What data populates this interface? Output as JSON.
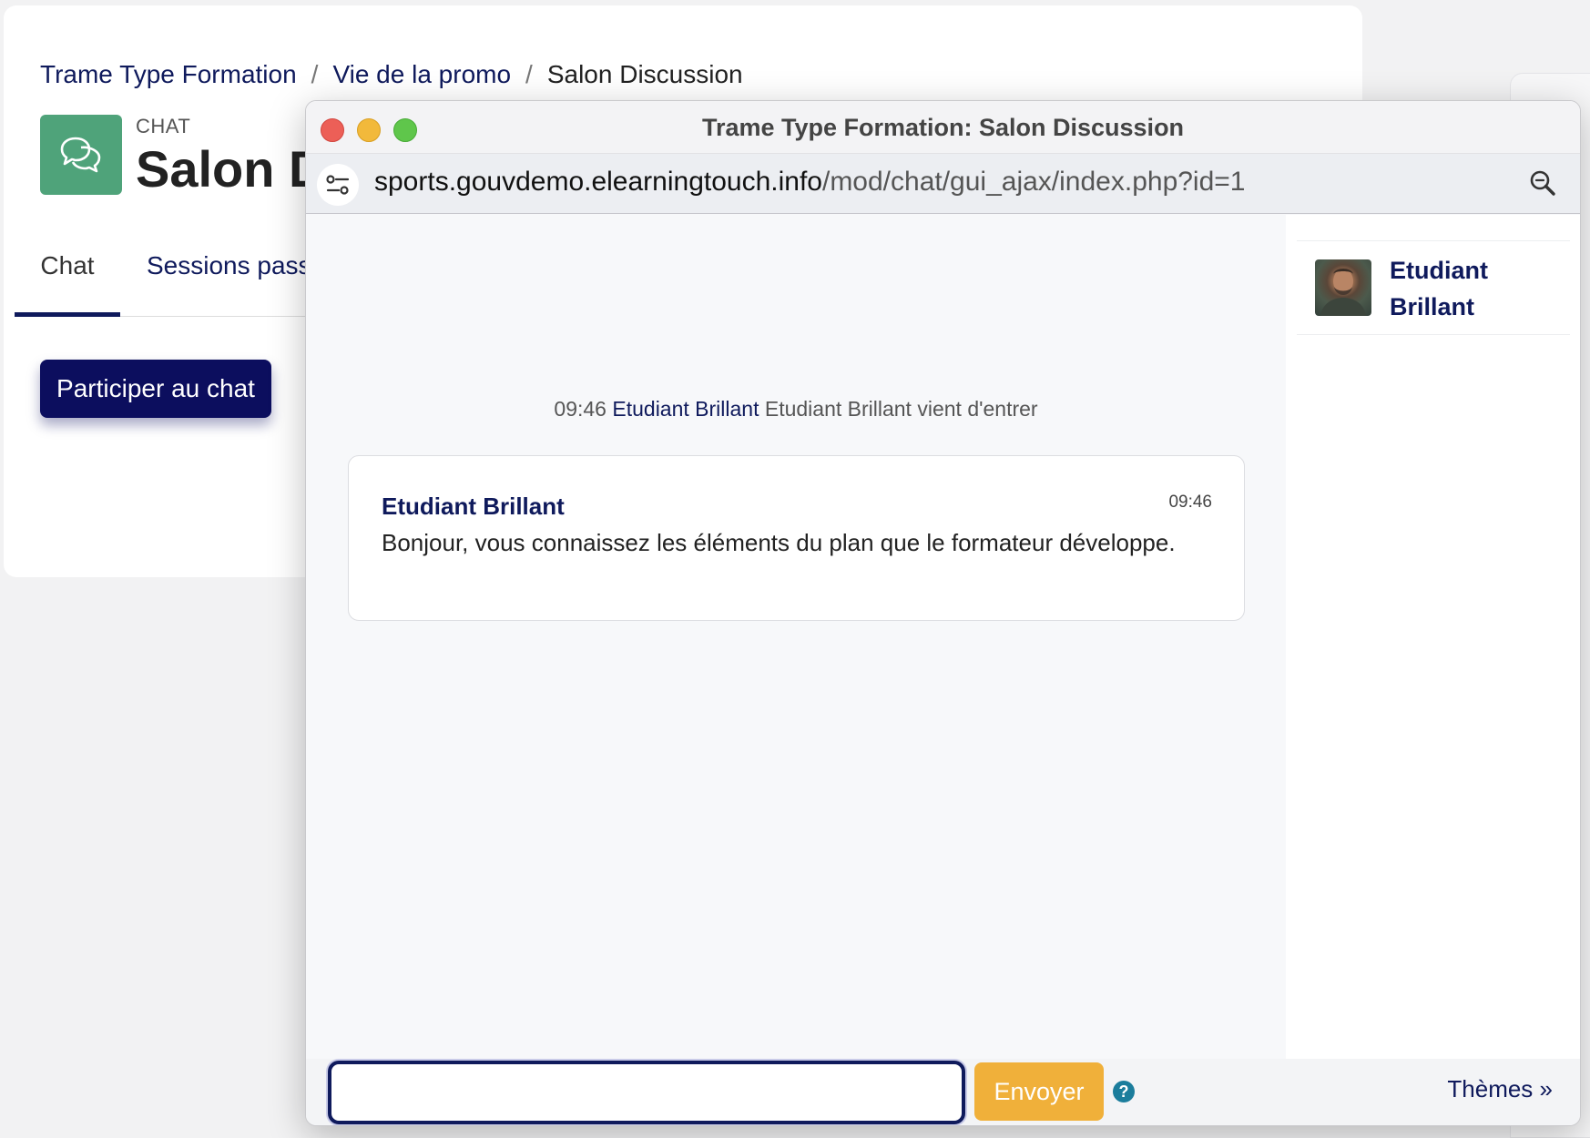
{
  "breadcrumb": {
    "items": [
      "Trame Type Formation",
      "Vie de la promo",
      "Salon Discussion"
    ],
    "separator": "/"
  },
  "module": {
    "type_label": "CHAT",
    "title": "Salon D",
    "icon": "chat-bubbles-icon",
    "icon_bg_color": "#4fa37a"
  },
  "tabs": {
    "chat": "Chat",
    "sessions": "Sessions pass"
  },
  "join_button": {
    "label": "Participer au chat",
    "color": "#0c0e5e"
  },
  "popup": {
    "window_title": "Trame Type Formation: Salon Discussion",
    "url_domain": "sports.gouvdemo.elearningtouch.info",
    "url_path": "/mod/chat/gui_ajax/index.php?id=1"
  },
  "chat": {
    "system_message": {
      "time": "09:46",
      "user": "Etudiant Brillant",
      "text": "Etudiant Brillant vient d'entrer"
    },
    "messages": [
      {
        "author": "Etudiant Brillant",
        "time": "09:46",
        "text": "Bonjour, vous connaissez les éléments du plan que le formateur développe."
      }
    ],
    "users": [
      {
        "name_line1": "Etudiant",
        "name_line2": "Brillant"
      }
    ],
    "input": {
      "value": "",
      "placeholder": ""
    },
    "send_label": "Envoyer",
    "send_color": "#f0b03a",
    "help_symbol": "?",
    "themes_label": "Thèmes »"
  },
  "colors": {
    "brand_navy": "#0f1a5c",
    "accent_orange": "#f0b03a"
  }
}
